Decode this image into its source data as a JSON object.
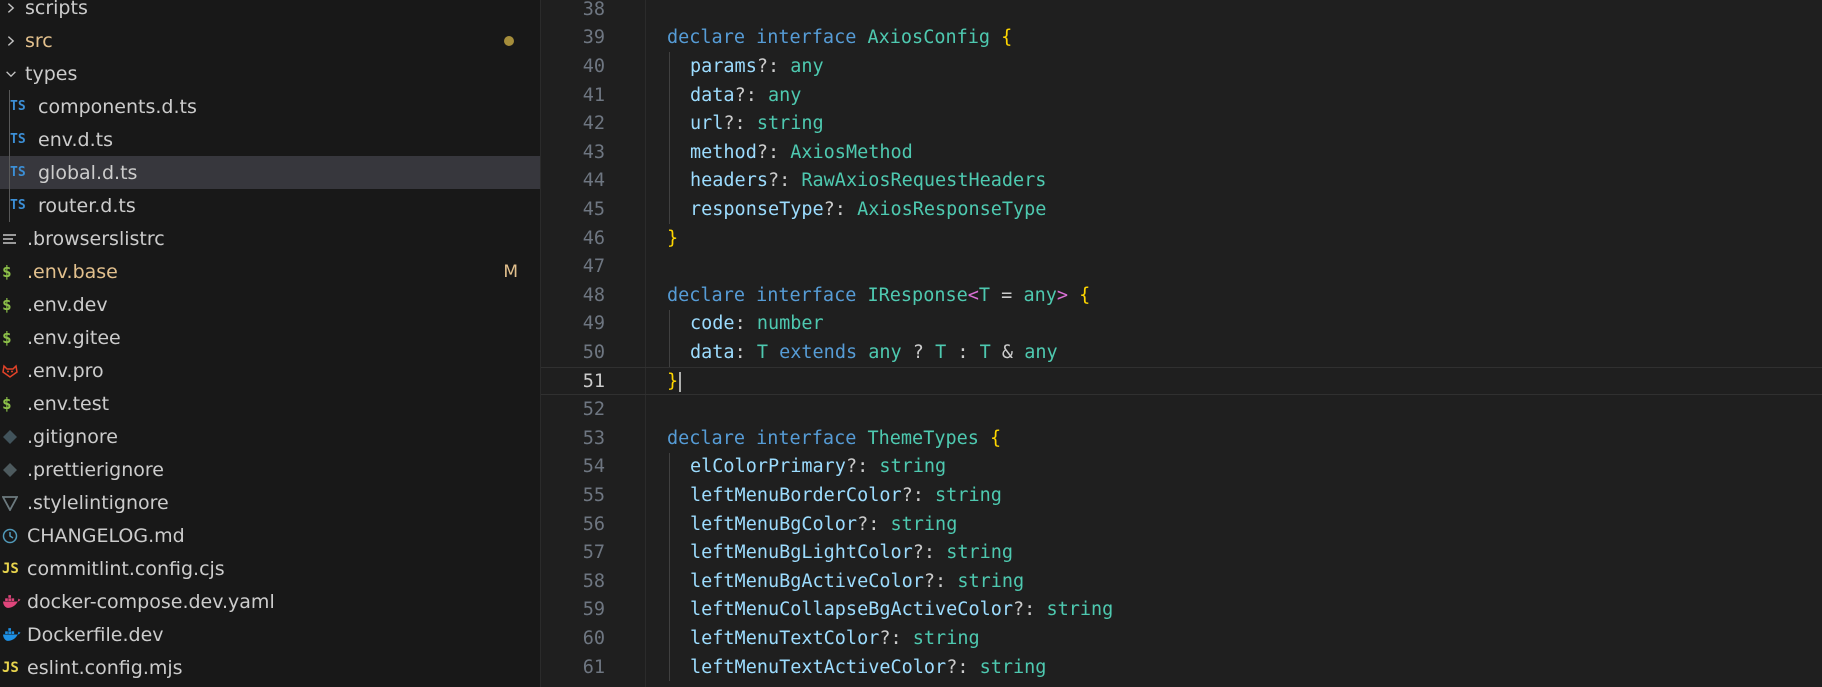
{
  "explorer": {
    "items": [
      {
        "label": "scripts",
        "kind": "folder-closed",
        "icon": "chevron-right-icon"
      },
      {
        "label": "src",
        "kind": "folder-closed",
        "icon": "chevron-right-icon",
        "modified_dot": true
      },
      {
        "label": "types",
        "kind": "folder-open",
        "icon": "chevron-down-icon"
      },
      {
        "label": "components.d.ts",
        "kind": "ts",
        "icon_text": "TS"
      },
      {
        "label": "env.d.ts",
        "kind": "ts",
        "icon_text": "TS"
      },
      {
        "label": "global.d.ts",
        "kind": "ts",
        "icon_text": "TS",
        "selected": true
      },
      {
        "label": "router.d.ts",
        "kind": "ts",
        "icon_text": "TS"
      },
      {
        "label": ".browserslistrc",
        "kind": "lines",
        "icon": "list-lines-icon"
      },
      {
        "label": ".env.base",
        "kind": "env",
        "icon_text": "$",
        "badge": "M"
      },
      {
        "label": ".env.dev",
        "kind": "env",
        "icon_text": "$"
      },
      {
        "label": ".env.gitee",
        "kind": "env",
        "icon_text": "$"
      },
      {
        "label": ".env.pro",
        "kind": "fox",
        "icon": "gitlab-fox-icon"
      },
      {
        "label": ".env.test",
        "kind": "env",
        "icon_text": "$"
      },
      {
        "label": ".gitignore",
        "kind": "git",
        "icon": "git-diamond-icon"
      },
      {
        "label": ".prettierignore",
        "kind": "git",
        "icon": "prettier-diamond-icon"
      },
      {
        "label": ".stylelintignore",
        "kind": "stylelint",
        "icon": "stylelint-icon"
      },
      {
        "label": "CHANGELOG.md",
        "kind": "clock",
        "icon": "clock-icon"
      },
      {
        "label": "commitlint.config.cjs",
        "kind": "js",
        "icon_text": "JS"
      },
      {
        "label": "docker-compose.dev.yaml",
        "kind": "docker",
        "icon": "docker-pink-icon"
      },
      {
        "label": "Dockerfile.dev",
        "kind": "docker",
        "icon": "docker-blue-icon"
      },
      {
        "label": "eslint.config.mjs",
        "kind": "js",
        "icon_text": "JS"
      }
    ]
  },
  "editor": {
    "current_line": 51,
    "lines": [
      {
        "n": "38",
        "tokens": []
      },
      {
        "n": "39",
        "tokens": [
          [
            "kw",
            "declare "
          ],
          [
            "kw",
            "interface "
          ],
          [
            "ty",
            "AxiosConfig "
          ],
          [
            "br2",
            "{"
          ]
        ]
      },
      {
        "n": "40",
        "indent": 1,
        "tokens": [
          [
            "pr",
            "params"
          ],
          [
            "p",
            "?: "
          ],
          [
            "ty",
            "any"
          ]
        ]
      },
      {
        "n": "41",
        "indent": 1,
        "tokens": [
          [
            "pr",
            "data"
          ],
          [
            "p",
            "?: "
          ],
          [
            "ty",
            "any"
          ]
        ]
      },
      {
        "n": "42",
        "indent": 1,
        "tokens": [
          [
            "pr",
            "url"
          ],
          [
            "p",
            "?: "
          ],
          [
            "ty",
            "string"
          ]
        ]
      },
      {
        "n": "43",
        "indent": 1,
        "tokens": [
          [
            "pr",
            "method"
          ],
          [
            "p",
            "?: "
          ],
          [
            "ty",
            "AxiosMethod"
          ]
        ]
      },
      {
        "n": "44",
        "indent": 1,
        "tokens": [
          [
            "pr",
            "headers"
          ],
          [
            "p",
            "?: "
          ],
          [
            "ty",
            "RawAxiosRequestHeaders"
          ]
        ]
      },
      {
        "n": "45",
        "indent": 1,
        "tokens": [
          [
            "pr",
            "responseType"
          ],
          [
            "p",
            "?: "
          ],
          [
            "ty",
            "AxiosResponseType"
          ]
        ]
      },
      {
        "n": "46",
        "tokens": [
          [
            "br2",
            "}"
          ]
        ]
      },
      {
        "n": "47",
        "tokens": []
      },
      {
        "n": "48",
        "tokens": [
          [
            "kw",
            "declare "
          ],
          [
            "kw",
            "interface "
          ],
          [
            "ty",
            "IResponse"
          ],
          [
            "br",
            "<"
          ],
          [
            "ty",
            "T "
          ],
          [
            "p",
            "= "
          ],
          [
            "ty",
            "any"
          ],
          [
            "br",
            ">"
          ],
          [
            "p",
            " "
          ],
          [
            "br2",
            "{"
          ]
        ]
      },
      {
        "n": "49",
        "indent": 1,
        "tokens": [
          [
            "pr",
            "code"
          ],
          [
            "p",
            ": "
          ],
          [
            "ty",
            "number"
          ]
        ]
      },
      {
        "n": "50",
        "indent": 1,
        "tokens": [
          [
            "pr",
            "data"
          ],
          [
            "p",
            ": "
          ],
          [
            "ty",
            "T "
          ],
          [
            "kw",
            "extends "
          ],
          [
            "ty",
            "any "
          ],
          [
            "p",
            "? "
          ],
          [
            "ty",
            "T "
          ],
          [
            "p",
            ": "
          ],
          [
            "ty",
            "T "
          ],
          [
            "p",
            "& "
          ],
          [
            "ty",
            "any"
          ]
        ]
      },
      {
        "n": "51",
        "tokens": [
          [
            "br2",
            "}"
          ]
        ]
      },
      {
        "n": "52",
        "tokens": []
      },
      {
        "n": "53",
        "tokens": [
          [
            "kw",
            "declare "
          ],
          [
            "kw",
            "interface "
          ],
          [
            "ty",
            "ThemeTypes "
          ],
          [
            "br2",
            "{"
          ]
        ]
      },
      {
        "n": "54",
        "indent": 1,
        "tokens": [
          [
            "pr",
            "elColorPrimary"
          ],
          [
            "p",
            "?: "
          ],
          [
            "ty",
            "string"
          ]
        ]
      },
      {
        "n": "55",
        "indent": 1,
        "tokens": [
          [
            "pr",
            "leftMenuBorderColor"
          ],
          [
            "p",
            "?: "
          ],
          [
            "ty",
            "string"
          ]
        ]
      },
      {
        "n": "56",
        "indent": 1,
        "tokens": [
          [
            "pr",
            "leftMenuBgColor"
          ],
          [
            "p",
            "?: "
          ],
          [
            "ty",
            "string"
          ]
        ]
      },
      {
        "n": "57",
        "indent": 1,
        "tokens": [
          [
            "pr",
            "leftMenuBgLightColor"
          ],
          [
            "p",
            "?: "
          ],
          [
            "ty",
            "string"
          ]
        ]
      },
      {
        "n": "58",
        "indent": 1,
        "tokens": [
          [
            "pr",
            "leftMenuBgActiveColor"
          ],
          [
            "p",
            "?: "
          ],
          [
            "ty",
            "string"
          ]
        ]
      },
      {
        "n": "59",
        "indent": 1,
        "tokens": [
          [
            "pr",
            "leftMenuCollapseBgActiveColor"
          ],
          [
            "p",
            "?: "
          ],
          [
            "ty",
            "string"
          ]
        ]
      },
      {
        "n": "60",
        "indent": 1,
        "tokens": [
          [
            "pr",
            "leftMenuTextColor"
          ],
          [
            "p",
            "?: "
          ],
          [
            "ty",
            "string"
          ]
        ]
      },
      {
        "n": "61",
        "indent": 1,
        "tokens": [
          [
            "pr",
            "leftMenuTextActiveColor"
          ],
          [
            "p",
            "?: "
          ],
          [
            "ty",
            "string"
          ]
        ]
      }
    ]
  },
  "colors": {
    "keyword": "#569cd6",
    "type": "#4ec9b0",
    "property": "#9cdcfe",
    "bracket": "#ffd700",
    "angle_bracket": "#da70d6",
    "modified": "#e2c08d",
    "selection": "#37373d"
  }
}
